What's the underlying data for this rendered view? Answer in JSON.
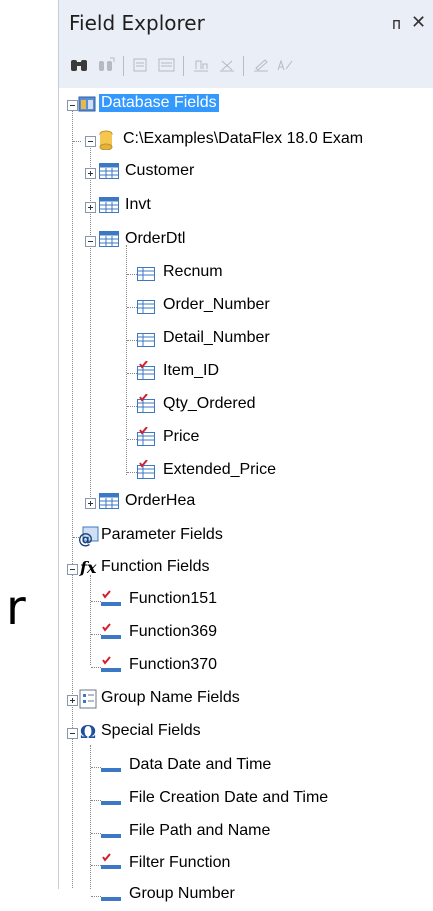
{
  "panel": {
    "title": "Field Explorer",
    "pin_glyph": "ᴨ",
    "close_glyph": "✕",
    "toolbar_icons": [
      "find-icon",
      "find-next-icon",
      "browse-field-data-icon",
      "insert-field-icon",
      "insert-summary-icon",
      "delete-icon",
      "edit-icon",
      "rename-icon"
    ]
  },
  "tree": {
    "database_fields": "Database Fields",
    "datasource": "C:\\Examples\\DataFlex 18.0 Exam",
    "tables": {
      "customer": "Customer",
      "invt": "Invt",
      "orderdtl": "OrderDtl",
      "orderhea": "OrderHea"
    },
    "orderdtl_fields": [
      "Recnum",
      "Order_Number",
      "Detail_Number",
      "Item_ID",
      "Qty_Ordered",
      "Price",
      "Extended_Price"
    ],
    "parameter_fields": "Parameter Fields",
    "function_fields": "Function Fields",
    "functions": [
      "Function151",
      "Function369",
      "Function370"
    ],
    "group_name_fields": "Group Name Fields",
    "special_fields": "Special Fields",
    "specials": [
      "Data Date and Time",
      "File Creation Date and Time",
      "File Path and Name",
      "Filter Function",
      "Group Number"
    ]
  },
  "left_fragment": "r",
  "colors": {
    "selection": "#3399ff",
    "panel_bg": "#eaeef6",
    "check_red": "#d11f2c",
    "table_blue": "#3c78c3"
  }
}
